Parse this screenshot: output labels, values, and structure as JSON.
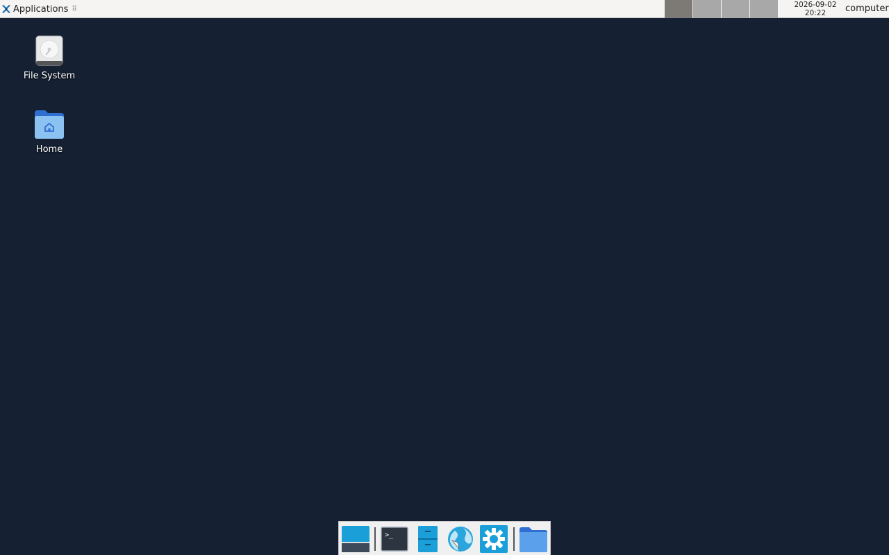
{
  "top_panel": {
    "applications_label": "Applications",
    "applications_grip": "⠿",
    "clock_date": "2026-09-02",
    "clock_time": "20:22",
    "user": "computer"
  },
  "desktop_icons": [
    {
      "label": "File System",
      "icon": "drive-harddisk-icon"
    },
    {
      "label": "Home",
      "icon": "home-folder-icon"
    }
  ],
  "dock": [
    {
      "icon": "show-desktop-icon"
    },
    {
      "icon": "terminal-icon",
      "glyph": ">_"
    },
    {
      "icon": "file-cabinet-icon"
    },
    {
      "icon": "web-browser-icon"
    },
    {
      "icon": "settings-gear-icon"
    },
    {
      "icon": "folder-icon"
    }
  ],
  "colors": {
    "desktop_background": "#152032",
    "panel_background": "#f5f4f2",
    "accent_blue": "#1a9fd8"
  }
}
